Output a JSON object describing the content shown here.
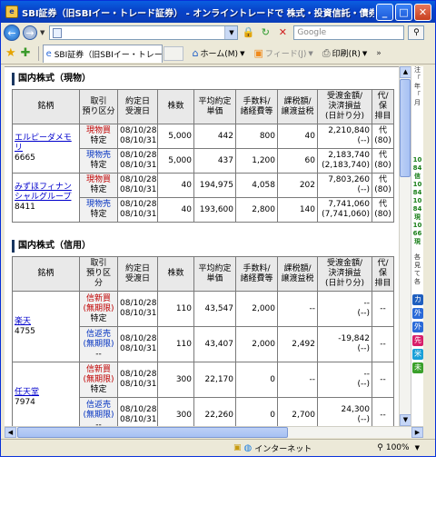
{
  "window": {
    "title": "SBI証券（旧SBIイー・トレード証券） - オンライントレードで 株式・投資信託・債券も - Win...",
    "app_icon": "ie-page-icon",
    "controls": [
      "minimize-icon",
      "maximize-icon",
      "close-icon"
    ]
  },
  "address_bar": {
    "url": "",
    "search_placeholder": "Google"
  },
  "command_bar": {
    "tab_label": "SBI証券（旧SBIイー・トレー...",
    "home_label": "ホーム(M)",
    "feed_label": "フィード(J)",
    "print_label": "印刷(R)"
  },
  "spot_section": {
    "title": "国内株式（現物）",
    "headers": [
      "銘柄",
      "取引\n預り区分",
      "約定日\n受渡日",
      "株数",
      "平均約定\n単価",
      "手数料/\n諸経費等",
      "課税額/\n譲渡益税",
      "受渡金額/\n決済損益\n(日計り分)",
      "代/保\n排目"
    ],
    "groups": [
      {
        "name": "エルピーダメモリ",
        "code": "6665",
        "rows": [
          {
            "trade": "現物買",
            "account": "特定",
            "date1": "08/10/28",
            "date2": "08/10/31",
            "qty": "5,000",
            "price": "442",
            "fee": "800",
            "tax": "40",
            "amount": "2,210,840",
            "pl": "(--)",
            "other1": "代",
            "other2": "(80)",
            "type": "buy"
          },
          {
            "trade": "現物売",
            "account": "特定",
            "date1": "08/10/28",
            "date2": "08/10/31",
            "qty": "5,000",
            "price": "437",
            "fee": "1,200",
            "tax": "60",
            "amount": "2,183,740",
            "pl": "(2,183,740)",
            "other1": "代",
            "other2": "(80)",
            "type": "sell"
          }
        ]
      },
      {
        "name": "みずほフィナンシャルグループ",
        "code": "8411",
        "rows": [
          {
            "trade": "現物買",
            "account": "特定",
            "date1": "08/10/28",
            "date2": "08/10/31",
            "qty": "40",
            "price": "194,975",
            "fee": "4,058",
            "tax": "202",
            "amount": "7,803,260",
            "pl": "(--)",
            "other1": "代",
            "other2": "(80)",
            "type": "buy"
          },
          {
            "trade": "現物売",
            "account": "特定",
            "date1": "08/10/28",
            "date2": "08/10/31",
            "qty": "40",
            "price": "193,600",
            "fee": "2,800",
            "tax": "140",
            "amount": "7,741,060",
            "pl": "(7,741,060)",
            "other1": "代",
            "other2": "(80)",
            "type": "sell"
          }
        ]
      }
    ]
  },
  "margin_section": {
    "title": "国内株式（信用）",
    "headers": [
      "銘柄",
      "取引\n預り区\n分",
      "約定日\n受渡日",
      "株数",
      "平均約定\n単価",
      "手数料/\n諸経費等",
      "課税額/\n譲渡益税",
      "受渡金額/\n決済損益\n(日計り分)",
      "代/保\n排目"
    ],
    "groups": [
      {
        "name": "楽天",
        "code": "4755",
        "rows": [
          {
            "trade": "信新買",
            "term": "(無期限)",
            "account": "特定",
            "date1": "08/10/28",
            "date2": "08/10/31",
            "qty": "110",
            "price": "43,547",
            "fee": "2,000",
            "tax": "--",
            "amount": "--",
            "pl": "(--)",
            "other": "--",
            "type": "buy"
          },
          {
            "trade": "信返売",
            "term": "(無期限)",
            "account": "--",
            "date1": "08/10/28",
            "date2": "08/10/31",
            "qty": "110",
            "price": "43,407",
            "fee": "2,000",
            "tax": "2,492",
            "amount": "-19,842",
            "pl": "(--)",
            "other": "--",
            "type": "sell"
          }
        ]
      },
      {
        "name": "任天堂",
        "code": "7974",
        "rows": [
          {
            "trade": "信新買",
            "term": "(無期限)",
            "account": "特定",
            "date1": "08/10/28",
            "date2": "08/10/31",
            "qty": "300",
            "price": "22,170",
            "fee": "0",
            "tax": "--",
            "amount": "--",
            "pl": "(--)",
            "other": "--",
            "type": "buy"
          },
          {
            "trade": "信返売",
            "term": "(無期限)",
            "account": "--",
            "date1": "08/10/28",
            "date2": "08/10/31",
            "qty": "300",
            "price": "22,260",
            "fee": "0",
            "tax": "2,700",
            "amount": "24,300",
            "pl": "(--)",
            "other": "--",
            "type": "sell"
          }
        ]
      }
    ]
  },
  "right_pane": {
    "texts": [
      "注",
      "「",
      "年",
      "「",
      "月"
    ],
    "items": [
      "10",
      "84",
      "信",
      "10",
      "84",
      "10",
      "84",
      "現",
      "10",
      "66",
      "現"
    ],
    "notes": [
      "各",
      "見",
      "て",
      "各"
    ],
    "buttons": [
      {
        "label": "カ",
        "color": "#1f5fbf"
      },
      {
        "label": "外",
        "color": "#2a6ad8"
      },
      {
        "label": "外",
        "color": "#2a6ad8"
      },
      {
        "label": "先",
        "color": "#d81e6a"
      },
      {
        "label": "米",
        "color": "#1aa0d8"
      },
      {
        "label": "未",
        "color": "#3aa02a"
      }
    ]
  },
  "status_bar": {
    "zone": "インターネット",
    "zoom": "100%"
  }
}
